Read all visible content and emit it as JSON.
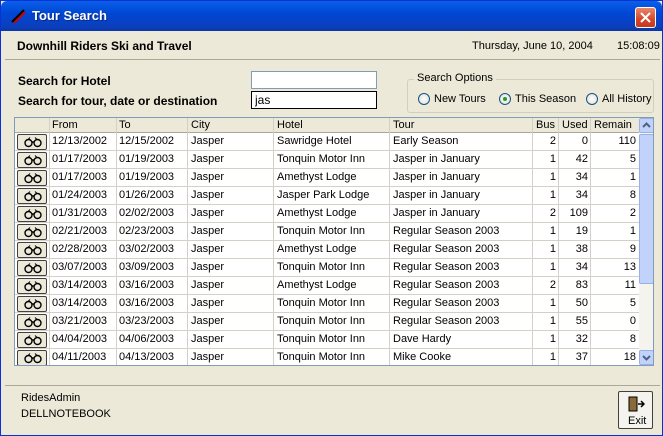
{
  "window": {
    "title": "Tour Search",
    "title_icon": "ski-icon",
    "close_icon": "close-icon"
  },
  "header": {
    "company": "Downhill Riders Ski and Travel",
    "date": "Thursday, June 10, 2004",
    "time": "15:08:09"
  },
  "search": {
    "hotel_label": "Search for Hotel",
    "hotel_value": "",
    "tour_label": "Search for tour, date or destination",
    "tour_value": "jas"
  },
  "options": {
    "legend": "Search Options",
    "items": [
      {
        "label": "New Tours",
        "selected": false
      },
      {
        "label": "This Season",
        "selected": true
      },
      {
        "label": "All History",
        "selected": false
      }
    ]
  },
  "grid": {
    "columns": [
      "From",
      "To",
      "City",
      "Hotel",
      "Tour",
      "Bus",
      "Used",
      "Remain"
    ],
    "row_icon": "binoculars-icon",
    "rows": [
      [
        "12/13/2002",
        "12/15/2002",
        "Jasper",
        "Sawridge Hotel",
        "Early Season",
        "2",
        "0",
        "110"
      ],
      [
        "01/17/2003",
        "01/19/2003",
        "Jasper",
        "Tonquin Motor Inn",
        "Jasper in January",
        "1",
        "42",
        "5"
      ],
      [
        "01/17/2003",
        "01/19/2003",
        "Jasper",
        "Amethyst Lodge",
        "Jasper in January",
        "1",
        "34",
        "1"
      ],
      [
        "01/24/2003",
        "01/26/2003",
        "Jasper",
        "Jasper Park Lodge",
        "Jasper in January",
        "1",
        "34",
        "8"
      ],
      [
        "01/31/2003",
        "02/02/2003",
        "Jasper",
        "Amethyst Lodge",
        "Jasper in January",
        "2",
        "109",
        "2"
      ],
      [
        "02/21/2003",
        "02/23/2003",
        "Jasper",
        "Tonquin Motor Inn",
        "Regular Season 2003",
        "1",
        "19",
        "1"
      ],
      [
        "02/28/2003",
        "03/02/2003",
        "Jasper",
        "Amethyst Lodge",
        "Regular Season 2003",
        "1",
        "38",
        "9"
      ],
      [
        "03/07/2003",
        "03/09/2003",
        "Jasper",
        "Tonquin Motor Inn",
        "Regular Season 2003",
        "1",
        "34",
        "13"
      ],
      [
        "03/14/2003",
        "03/16/2003",
        "Jasper",
        "Amethyst Lodge",
        "Regular Season 2003",
        "2",
        "83",
        "11"
      ],
      [
        "03/14/2003",
        "03/16/2003",
        "Jasper",
        "Tonquin Motor Inn",
        "Regular Season 2003",
        "1",
        "50",
        "5"
      ],
      [
        "03/21/2003",
        "03/23/2003",
        "Jasper",
        "Tonquin Motor Inn",
        "Regular Season 2003",
        "1",
        "55",
        "0"
      ],
      [
        "04/04/2003",
        "04/06/2003",
        "Jasper",
        "Tonquin Motor Inn",
        "Dave Hardy",
        "1",
        "32",
        "8"
      ],
      [
        "04/11/2003",
        "04/13/2003",
        "Jasper",
        "Tonquin Motor Inn",
        "Mike Cooke",
        "1",
        "37",
        "18"
      ]
    ]
  },
  "footer": {
    "user": "RidesAdmin",
    "machine": "DELLNOTEBOOK",
    "exit_label": "Exit",
    "exit_icon": "exit-door-icon"
  }
}
